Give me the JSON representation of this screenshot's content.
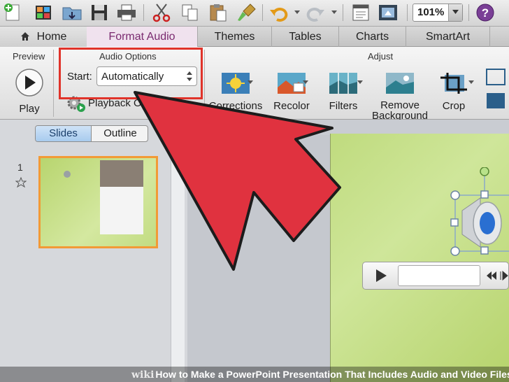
{
  "toolbar": {
    "icons": [
      "new-icon",
      "gallery-icon",
      "open-icon",
      "save-icon",
      "print-icon",
      "cut-icon",
      "copy-icon",
      "paste-icon",
      "format-painter-icon",
      "undo-icon",
      "redo-icon",
      "show-slide-icon",
      "media-browser-icon",
      "help-icon"
    ],
    "zoom_value": "101%"
  },
  "tabs": {
    "home": "Home",
    "format_audio": "Format Audio",
    "themes": "Themes",
    "tables": "Tables",
    "charts": "Charts",
    "smartart": "SmartArt"
  },
  "ribbon": {
    "preview_group": "Preview",
    "play_label": "Play",
    "audio_options_group": "Audio Options",
    "start_label": "Start:",
    "start_value": "Automatically",
    "playback_label": "Playback O",
    "adjust_group": "Adjust",
    "corrections": "Corrections",
    "recolor": "Recolor",
    "filters": "Filters",
    "remove_background_line1": "Remove",
    "remove_background_line2": "Background",
    "crop": "Crop",
    "accent_color": "#e0332a"
  },
  "sidebar": {
    "slides_tab": "Slides",
    "outline_tab": "Outline",
    "slide_number": "1"
  },
  "caption": {
    "brand": "wiki",
    "text": "How to Make a PowerPoint Presentation That Includes Audio and Video Files"
  }
}
